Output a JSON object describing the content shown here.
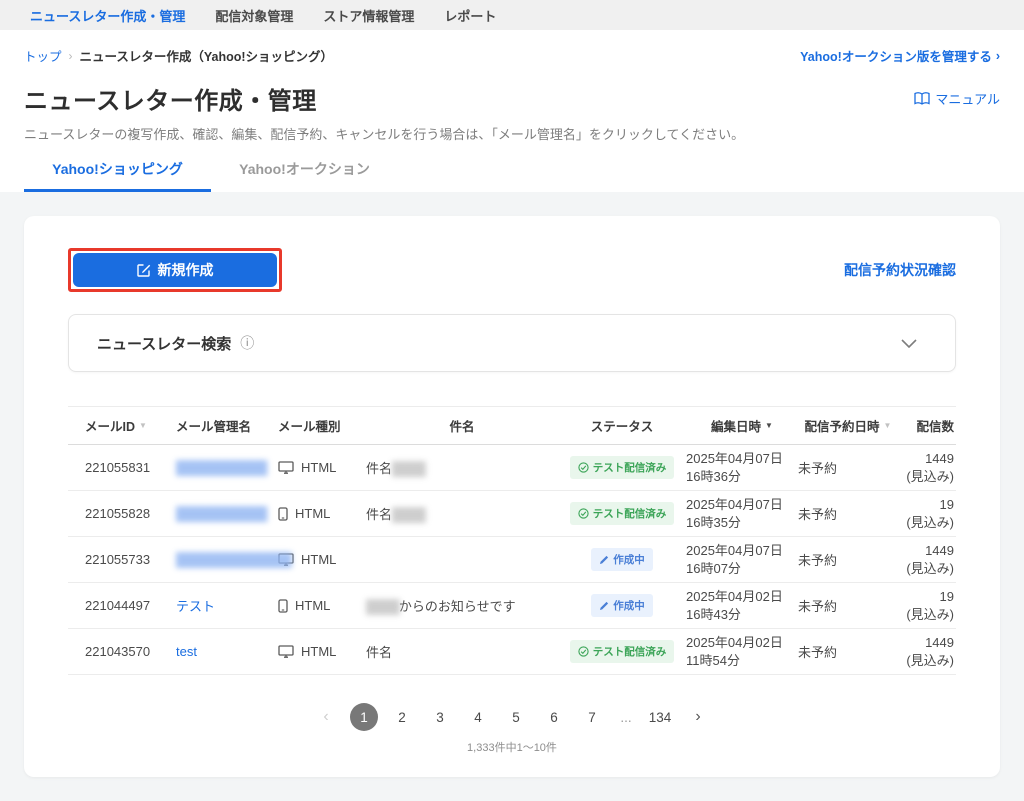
{
  "top_nav": {
    "items": [
      {
        "label": "ニュースレター作成・管理",
        "active": true
      },
      {
        "label": "配信対象管理",
        "active": false
      },
      {
        "label": "ストア情報管理",
        "active": false
      },
      {
        "label": "レポート",
        "active": false
      }
    ]
  },
  "breadcrumb": {
    "home": "トップ",
    "current": "ニュースレター作成（Yahoo!ショッピング）"
  },
  "header": {
    "auction_link": "Yahoo!オークション版を管理する",
    "title": "ニュースレター作成・管理",
    "description": "ニュースレターの複写作成、確認、編集、配信予約、キャンセルを行う場合は、「メール管理名」をクリックしてください。",
    "manual_link": "マニュアル"
  },
  "tabs": [
    {
      "label": "Yahoo!ショッピング",
      "active": true
    },
    {
      "label": "Yahoo!オークション",
      "active": false
    }
  ],
  "toolbar": {
    "create_button": "新規作成",
    "schedule_status_link": "配信予約状況確認"
  },
  "search_panel": {
    "title": "ニュースレター検索"
  },
  "table": {
    "headers": {
      "mail_id": "メールID",
      "manage_name": "メール管理名",
      "mail_type": "メール種別",
      "subject": "件名",
      "status": "ステータス",
      "edited": "編集日時",
      "scheduled": "配信予約日時",
      "count": "配信数"
    },
    "rows": [
      {
        "mail_id": "221055831",
        "manage_name": "███████████",
        "type": "HTML",
        "subject_prefix": "件名",
        "subject_redacted": "████",
        "subject_suffix": "",
        "status": "テスト配信済み",
        "edited_date": "2025年04月07日",
        "edited_time": "16時36分",
        "scheduled": "未予約",
        "count": "1449",
        "count_note": "(見込み)"
      },
      {
        "mail_id": "221055828",
        "manage_name": "███████████",
        "type": "HTML",
        "subject_prefix": "件名",
        "subject_redacted": "████",
        "subject_suffix": "",
        "status": "テスト配信済み",
        "edited_date": "2025年04月07日",
        "edited_time": "16時35分",
        "scheduled": "未予約",
        "count": "19",
        "count_note": "(見込み)"
      },
      {
        "mail_id": "221055733",
        "manage_name": "██████████████",
        "type": "HTML",
        "subject_prefix": "",
        "subject_redacted": "",
        "subject_suffix": "",
        "status": "作成中",
        "edited_date": "2025年04月07日",
        "edited_time": "16時07分",
        "scheduled": "未予約",
        "count": "1449",
        "count_note": "(見込み)"
      },
      {
        "mail_id": "221044497",
        "manage_name": "テスト",
        "type": "HTML",
        "subject_prefix": "",
        "subject_redacted": "████",
        "subject_suffix": "からのお知らせです",
        "status": "作成中",
        "edited_date": "2025年04月02日",
        "edited_time": "16時43分",
        "scheduled": "未予約",
        "count": "19",
        "count_note": "(見込み)"
      },
      {
        "mail_id": "221043570",
        "manage_name": "test",
        "type": "HTML",
        "subject_prefix": "件名",
        "subject_redacted": "",
        "subject_suffix": "",
        "status": "テスト配信済み",
        "edited_date": "2025年04月02日",
        "edited_time": "11時54分",
        "scheduled": "未予約",
        "count": "1449",
        "count_note": "(見込み)"
      }
    ]
  },
  "pagination": {
    "pages": [
      "1",
      "2",
      "3",
      "4",
      "5",
      "6",
      "7",
      "...",
      "134"
    ],
    "active_page": "1",
    "summary": "1,333件中1〜10件"
  },
  "icons": {
    "breadcrumb_separator": "›",
    "link_chevron": "›",
    "info": "ⓘ",
    "sort_desc": "▼",
    "prev": "‹",
    "next": "›"
  },
  "colors": {
    "accent_blue": "#1a6de0",
    "annotation_red": "#e8392b",
    "badge_success_bg": "#e9f6ec",
    "badge_success_text": "#3ba457",
    "badge_draft_bg": "#e9f1fd",
    "badge_draft_text": "#4a7fd6"
  }
}
